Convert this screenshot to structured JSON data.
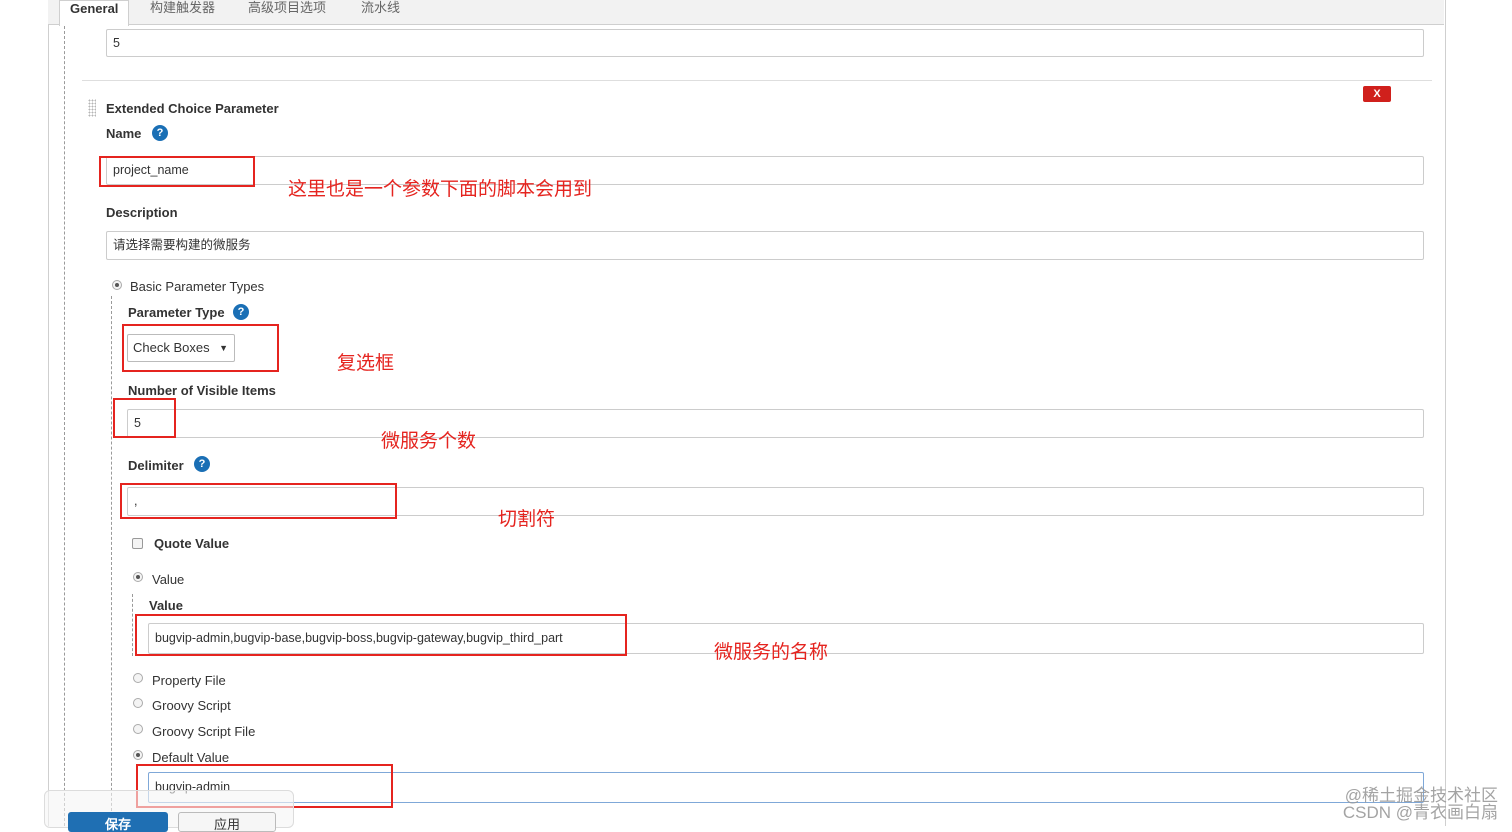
{
  "tabs": [
    {
      "label": "General",
      "active": true
    },
    {
      "label": "构建触发器",
      "active": false
    },
    {
      "label": "高级项目选项",
      "active": false
    },
    {
      "label": "流水线",
      "active": false
    }
  ],
  "top_field_value": "5",
  "section": {
    "title": "Extended Choice Parameter",
    "delete_label": "X",
    "name_label": "Name",
    "name_value": "project_name",
    "description_label": "Description",
    "description_value": "请选择需要构建的微服务",
    "basic_param_types_label": "Basic Parameter Types",
    "param_type_label": "Parameter Type",
    "param_type_value": "Check Boxes",
    "visible_items_label": "Number of Visible Items",
    "visible_items_value": "5",
    "delimiter_label": "Delimiter",
    "delimiter_value": ",",
    "quote_value_label": "Quote Value",
    "value_radio_label": "Value",
    "value_label": "Value",
    "value_value": "bugvip-admin,bugvip-base,bugvip-boss,bugvip-gateway,bugvip_third_part",
    "property_file_label": "Property File",
    "groovy_script_label": "Groovy Script",
    "groovy_script_file_label": "Groovy Script File",
    "default_value_label": "Default Value",
    "default_value_value": "bugvip-admin"
  },
  "buttons": {
    "save": "保存",
    "apply": "应用"
  },
  "annotations": {
    "name_note": "这里也是一个参数下面的脚本会用到",
    "type_note": "复选框",
    "count_note": "微服务个数",
    "delimiter_note": "切割符",
    "value_note": "微服务的名称"
  },
  "watermark": {
    "line1": "@稀土掘金技术社区",
    "line2": "CSDN @青衣画白扇"
  },
  "colors": {
    "annotation_red": "#e5241f",
    "help_blue": "#1a6fb5",
    "save_blue": "#1f6fb3",
    "delete_red": "#d0201c"
  }
}
